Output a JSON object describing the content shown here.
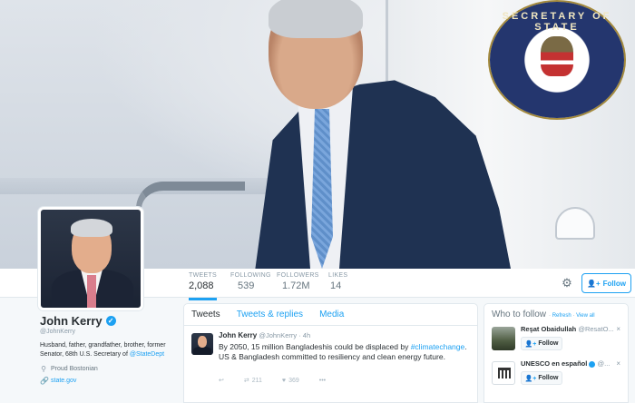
{
  "profile": {
    "name": "John Kerry",
    "handle": "@JohnKerry",
    "bio_text": "Husband, father, grandfather, brother, former Senator, 68th U.S. Secretary of ",
    "bio_mention": "@StateDept",
    "location": "Proud Bostonian",
    "website": "state.gov"
  },
  "header": {
    "seal_text": "SECRETARY OF STATE"
  },
  "stats": [
    {
      "label": "TWEETS",
      "value": "2,088"
    },
    {
      "label": "FOLLOWING",
      "value": "539"
    },
    {
      "label": "FOLLOWERS",
      "value": "1.72M"
    },
    {
      "label": "LIKES",
      "value": "14"
    }
  ],
  "actions": {
    "follow_label": "Follow",
    "settings_icon": "gear-icon"
  },
  "timeline": {
    "tabs": [
      "Tweets",
      "Tweets & replies",
      "Media"
    ],
    "tweet": {
      "name": "John Kerry",
      "handle": "@JohnKerry",
      "time": "· 4h",
      "text_1": "By 2050, 15 million Bangladeshis could be displaced by ",
      "hashtag": "#climatechange",
      "text_2": ". US & Bangladesh committed to resiliency and clean energy future.",
      "retweets": "211",
      "likes": "369"
    }
  },
  "who_to_follow": {
    "title": "Who to follow",
    "refresh": "Refresh",
    "view_all": "View all",
    "follow_label": "Follow",
    "accounts": [
      {
        "name": "Reşat Obaidullah",
        "handle": "@ResatO..."
      },
      {
        "name": "UNESCO en español",
        "handle": "@..."
      }
    ]
  },
  "colors": {
    "accent": "#1da1f2",
    "text": "#292f33",
    "muted": "#8899a6"
  }
}
